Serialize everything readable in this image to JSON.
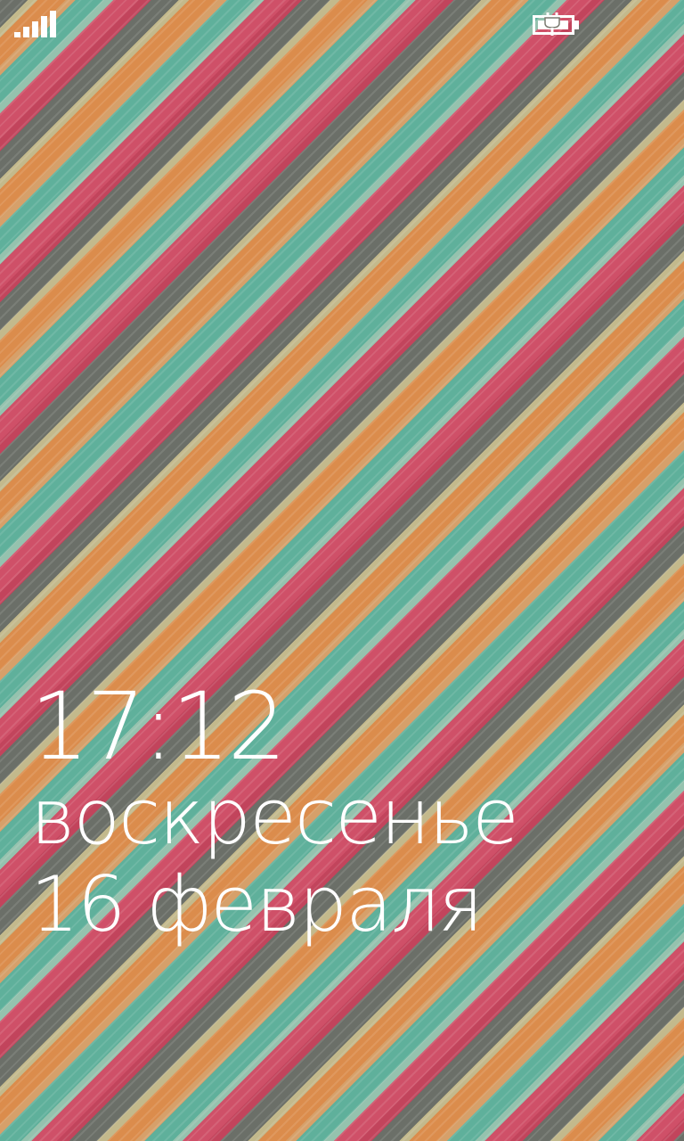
{
  "status_bar": {
    "signal_icon": "signal-strength-icon",
    "battery_icon": "battery-charging-icon"
  },
  "lock_screen": {
    "time": "17:12",
    "weekday": "воскресенье",
    "date": "16 февраля"
  },
  "colors": {
    "text": "#ffffff",
    "stripe_gray": "#6b6f68",
    "stripe_orange": "#db8c4c",
    "stripe_teal": "#5fb09b",
    "stripe_pink": "#cf5068"
  }
}
